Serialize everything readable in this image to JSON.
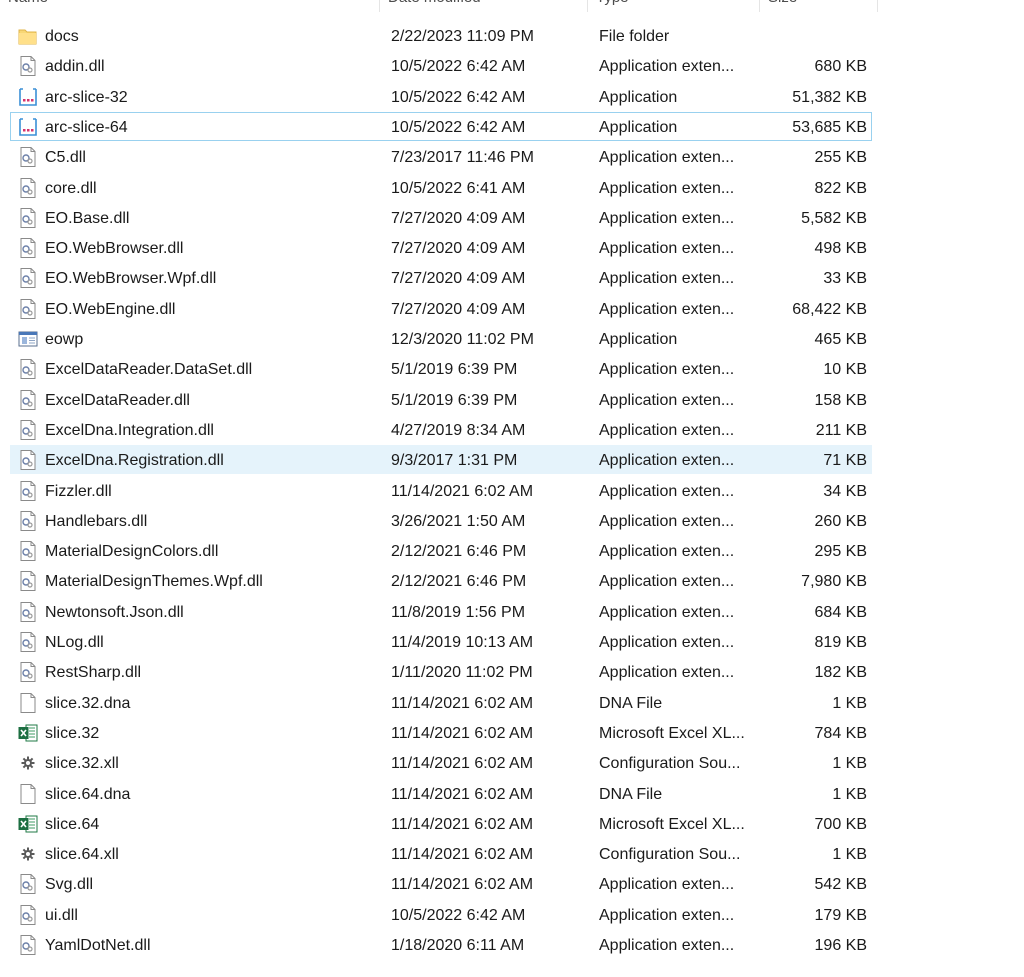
{
  "header": {
    "columns": [
      "Name",
      "Date modified",
      "Type",
      "Size"
    ]
  },
  "rows": [
    {
      "name": "docs",
      "date": "2/22/2023 11:09 PM",
      "type": "File folder",
      "size": "",
      "icon": "folder-icon"
    },
    {
      "name": "addin.dll",
      "date": "10/5/2022 6:42 AM",
      "type": "Application exten...",
      "size": "680 KB",
      "icon": "dll-icon"
    },
    {
      "name": "arc-slice-32",
      "date": "10/5/2022 6:42 AM",
      "type": "Application",
      "size": "51,382 KB",
      "icon": "app-exe-icon"
    },
    {
      "name": "arc-slice-64",
      "date": "10/5/2022 6:42 AM",
      "type": "Application",
      "size": "53,685 KB",
      "icon": "app-exe-icon",
      "state": "focused"
    },
    {
      "name": "C5.dll",
      "date": "7/23/2017 11:46 PM",
      "type": "Application exten...",
      "size": "255 KB",
      "icon": "dll-icon"
    },
    {
      "name": "core.dll",
      "date": "10/5/2022 6:41 AM",
      "type": "Application exten...",
      "size": "822 KB",
      "icon": "dll-icon"
    },
    {
      "name": "EO.Base.dll",
      "date": "7/27/2020 4:09 AM",
      "type": "Application exten...",
      "size": "5,582 KB",
      "icon": "dll-icon"
    },
    {
      "name": "EO.WebBrowser.dll",
      "date": "7/27/2020 4:09 AM",
      "type": "Application exten...",
      "size": "498 KB",
      "icon": "dll-icon"
    },
    {
      "name": "EO.WebBrowser.Wpf.dll",
      "date": "7/27/2020 4:09 AM",
      "type": "Application exten...",
      "size": "33 KB",
      "icon": "dll-icon"
    },
    {
      "name": "EO.WebEngine.dll",
      "date": "7/27/2020 4:09 AM",
      "type": "Application exten...",
      "size": "68,422 KB",
      "icon": "dll-icon"
    },
    {
      "name": "eowp",
      "date": "12/3/2020 11:02 PM",
      "type": "Application",
      "size": "465 KB",
      "icon": "window-app-icon"
    },
    {
      "name": "ExcelDataReader.DataSet.dll",
      "date": "5/1/2019 6:39 PM",
      "type": "Application exten...",
      "size": "10 KB",
      "icon": "dll-icon"
    },
    {
      "name": "ExcelDataReader.dll",
      "date": "5/1/2019 6:39 PM",
      "type": "Application exten...",
      "size": "158 KB",
      "icon": "dll-icon"
    },
    {
      "name": "ExcelDna.Integration.dll",
      "date": "4/27/2019 8:34 AM",
      "type": "Application exten...",
      "size": "211 KB",
      "icon": "dll-icon"
    },
    {
      "name": "ExcelDna.Registration.dll",
      "date": "9/3/2017 1:31 PM",
      "type": "Application exten...",
      "size": "71 KB",
      "icon": "dll-icon",
      "state": "selected"
    },
    {
      "name": "Fizzler.dll",
      "date": "11/14/2021 6:02 AM",
      "type": "Application exten...",
      "size": "34 KB",
      "icon": "dll-icon"
    },
    {
      "name": "Handlebars.dll",
      "date": "3/26/2021 1:50 AM",
      "type": "Application exten...",
      "size": "260 KB",
      "icon": "dll-icon"
    },
    {
      "name": "MaterialDesignColors.dll",
      "date": "2/12/2021 6:46 PM",
      "type": "Application exten...",
      "size": "295 KB",
      "icon": "dll-icon"
    },
    {
      "name": "MaterialDesignThemes.Wpf.dll",
      "date": "2/12/2021 6:46 PM",
      "type": "Application exten...",
      "size": "7,980 KB",
      "icon": "dll-icon"
    },
    {
      "name": "Newtonsoft.Json.dll",
      "date": "11/8/2019 1:56 PM",
      "type": "Application exten...",
      "size": "684 KB",
      "icon": "dll-icon"
    },
    {
      "name": "NLog.dll",
      "date": "11/4/2019 10:13 AM",
      "type": "Application exten...",
      "size": "819 KB",
      "icon": "dll-icon"
    },
    {
      "name": "RestSharp.dll",
      "date": "1/11/2020 11:02 PM",
      "type": "Application exten...",
      "size": "182 KB",
      "icon": "dll-icon"
    },
    {
      "name": "slice.32.dna",
      "date": "11/14/2021 6:02 AM",
      "type": "DNA File",
      "size": "1 KB",
      "icon": "blank-file-icon"
    },
    {
      "name": "slice.32",
      "date": "11/14/2021 6:02 AM",
      "type": "Microsoft Excel XL...",
      "size": "784 KB",
      "icon": "excel-icon"
    },
    {
      "name": "slice.32.xll",
      "date": "11/14/2021 6:02 AM",
      "type": "Configuration Sou...",
      "size": "1 KB",
      "icon": "config-gear-icon"
    },
    {
      "name": "slice.64.dna",
      "date": "11/14/2021 6:02 AM",
      "type": "DNA File",
      "size": "1 KB",
      "icon": "blank-file-icon"
    },
    {
      "name": "slice.64",
      "date": "11/14/2021 6:02 AM",
      "type": "Microsoft Excel XL...",
      "size": "700 KB",
      "icon": "excel-icon"
    },
    {
      "name": "slice.64.xll",
      "date": "11/14/2021 6:02 AM",
      "type": "Configuration Sou...",
      "size": "1 KB",
      "icon": "config-gear-icon"
    },
    {
      "name": "Svg.dll",
      "date": "11/14/2021 6:02 AM",
      "type": "Application exten...",
      "size": "542 KB",
      "icon": "dll-icon"
    },
    {
      "name": "ui.dll",
      "date": "10/5/2022 6:42 AM",
      "type": "Application exten...",
      "size": "179 KB",
      "icon": "dll-icon"
    },
    {
      "name": "YamlDotNet.dll",
      "date": "1/18/2020 6:11 AM",
      "type": "Application exten...",
      "size": "196 KB",
      "icon": "dll-icon"
    }
  ]
}
